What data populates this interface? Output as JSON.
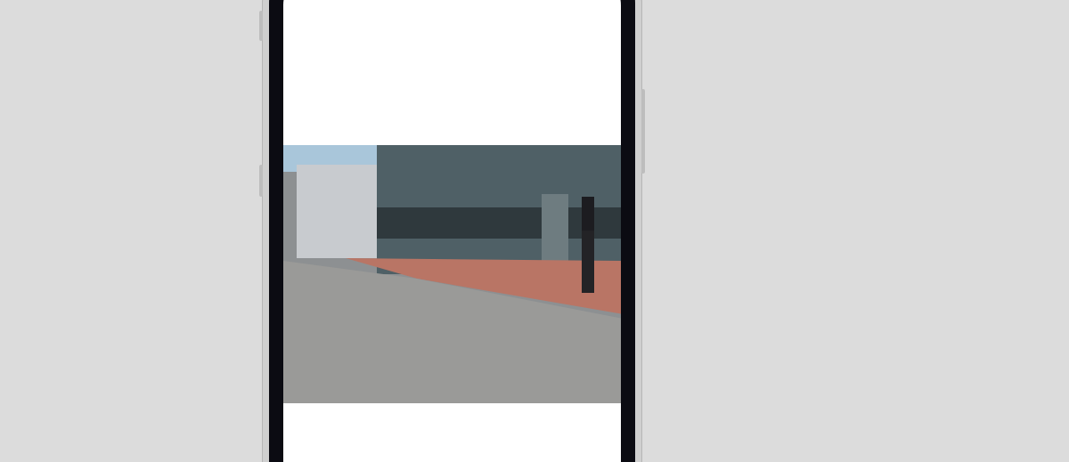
{
  "device": {
    "kind": "phone"
  },
  "screen": {
    "media": {
      "kind": "video"
    }
  }
}
